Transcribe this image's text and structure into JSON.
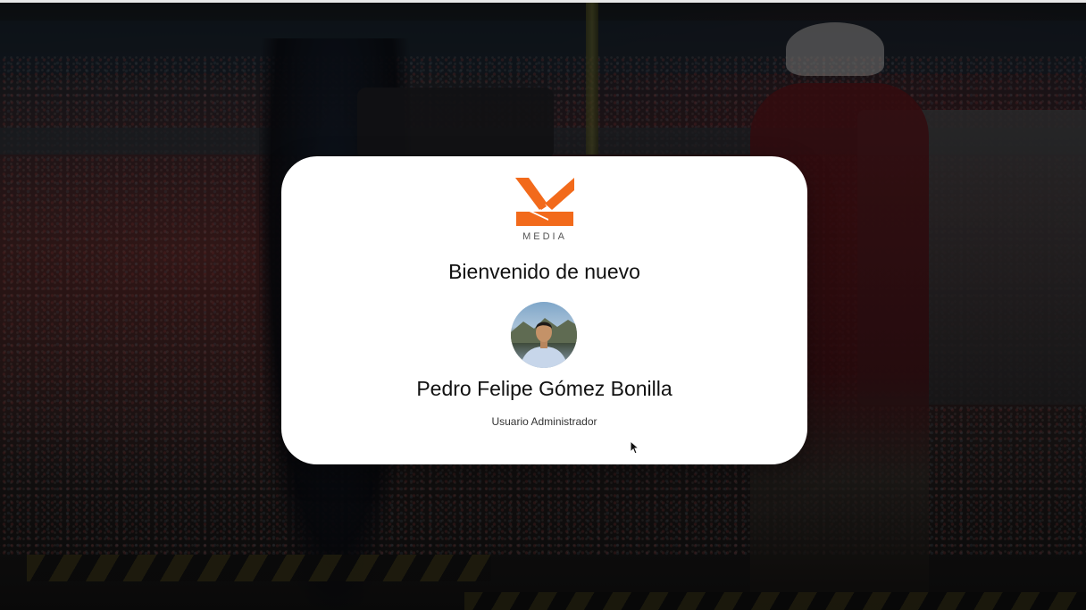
{
  "welcome": {
    "logo_text": "MEDIA",
    "greeting": "Bienvenido de nuevo",
    "user_name": "Pedro Felipe Gómez Bonilla",
    "user_role": "Usuario Administrador"
  },
  "colors": {
    "brand_orange": "#f26a1b",
    "card_background": "#ffffff"
  },
  "icons": {
    "logo": "media-logo-icon",
    "avatar": "user-avatar",
    "cursor": "mouse-cursor-icon"
  }
}
